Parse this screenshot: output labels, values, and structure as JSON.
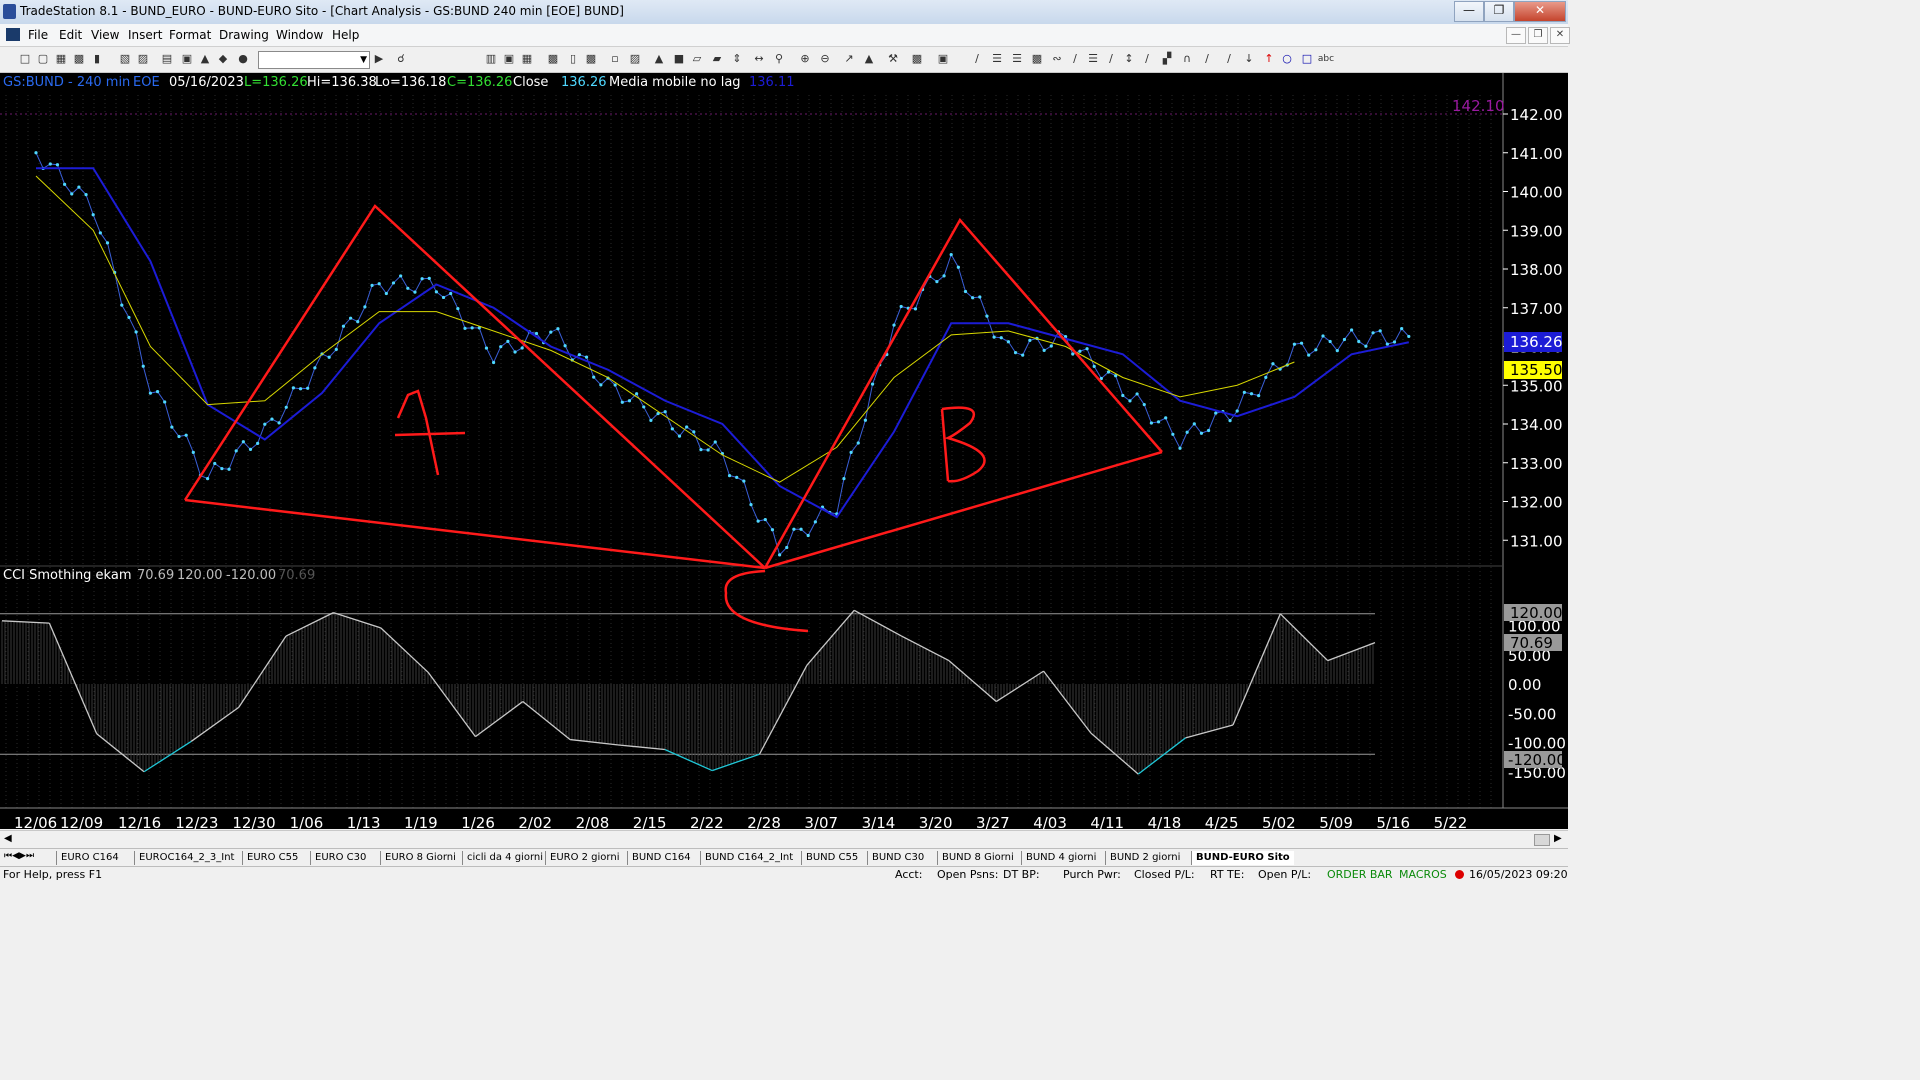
{
  "window": {
    "title": "TradeStation 8.1 - BUND_EURO - BUND-EURO Sito - [Chart Analysis - GS:BUND  240 min  [EOE] BUND]",
    "min_icon": "minimize-icon",
    "max_icon": "maximize-icon",
    "close_icon": "close-icon"
  },
  "menu": [
    "File",
    "Edit",
    "View",
    "Insert",
    "Format",
    "Drawing",
    "Window",
    "Help"
  ],
  "chart_header": {
    "symbol": "GS:BUND - 240 min",
    "session": "EOE",
    "date": "05/16/2023",
    "last": "L=136.26",
    "high": "Hi=136.38",
    "low": "Lo=136.18",
    "close_val": "C=136.26",
    "close_label": "Close",
    "close_num": "136.26",
    "ma_label": "Media mobile no lag",
    "ma_value": "136.11"
  },
  "indicator_header": {
    "name": "CCI Smothing ekam",
    "v1": "70.69",
    "v2": "120.00",
    "v3": "-120.00",
    "v4": "70.69"
  },
  "price_axis": {
    "labels": [
      "142.00",
      "141.00",
      "140.00",
      "139.00",
      "138.00",
      "137.00",
      "136.00",
      "135.00",
      "134.00",
      "133.00",
      "132.00",
      "131.00"
    ],
    "marker_last": "136.26",
    "marker_ma": "135.50",
    "top_ref": "142.10"
  },
  "cci_axis": {
    "labels": [
      "100.00",
      "50.00",
      "0.00",
      "-50.00",
      "-100.00",
      "-150.00"
    ],
    "marker_upper": "120.00",
    "marker_value": "70.69",
    "marker_lower": "-120.00"
  },
  "time_axis": [
    "12/06",
    "12/09",
    "12/16",
    "12/23",
    "12/30",
    "1/06",
    "1/13",
    "1/19",
    "1/26",
    "2/02",
    "2/08",
    "2/15",
    "2/22",
    "2/28",
    "3/07",
    "3/14",
    "3/20",
    "3/27",
    "4/03",
    "4/11",
    "4/18",
    "4/25",
    "5/02",
    "5/09",
    "5/16",
    "5/22"
  ],
  "annotations": {
    "letter_a": "A",
    "letter_b": "B",
    "letter_c": "C"
  },
  "chart_data": {
    "type": "line",
    "x_dates": [
      "12/06",
      "12/09",
      "12/16",
      "12/23",
      "12/30",
      "1/06",
      "1/13",
      "1/19",
      "1/26",
      "2/02",
      "2/08",
      "2/15",
      "2/22",
      "2/28",
      "3/07",
      "3/14",
      "3/20",
      "3/27",
      "4/03",
      "4/11",
      "4/18",
      "4/25",
      "5/02",
      "5/09",
      "5/16"
    ],
    "ylim": [
      130.4,
      142.4
    ],
    "series": [
      {
        "name": "Close",
        "color": "#4fd8ff",
        "values": [
          141.0,
          139.6,
          135.0,
          132.6,
          133.8,
          135.6,
          137.6,
          137.6,
          135.8,
          136.4,
          135.0,
          134.1,
          133.2,
          130.8,
          131.9,
          136.6,
          138.2,
          135.9,
          136.2,
          134.9,
          133.6,
          134.4,
          135.9,
          136.2,
          136.26
        ]
      },
      {
        "name": "Media mobile no lag",
        "color": "#1c1cd6",
        "values": [
          140.6,
          140.6,
          138.2,
          134.5,
          133.6,
          134.8,
          136.6,
          137.6,
          137.0,
          136.0,
          135.4,
          134.6,
          134.0,
          132.4,
          131.6,
          133.8,
          136.6,
          136.6,
          136.2,
          135.8,
          134.6,
          134.2,
          134.7,
          135.8,
          136.11
        ]
      },
      {
        "name": "Average",
        "color": "#d8d800",
        "values": [
          140.4,
          139.0,
          136.0,
          134.5,
          134.6,
          135.8,
          136.9,
          136.9,
          136.4,
          135.9,
          135.2,
          134.2,
          133.2,
          132.5,
          133.4,
          135.2,
          136.3,
          136.4,
          136.0,
          135.2,
          134.7,
          135.0,
          135.6,
          null,
          null
        ]
      }
    ],
    "cci": {
      "name": "CCI Smothing ekam",
      "ylim": [
        -160,
        140
      ],
      "levels": [
        120,
        -120
      ],
      "values": [
        108,
        104,
        -85,
        -150,
        -98,
        -40,
        82,
        122,
        96,
        20,
        -90,
        -30,
        -95,
        -104,
        -112,
        -148,
        -120,
        32,
        126,
        82,
        40,
        -30,
        22,
        -84,
        -154,
        -92,
        -70,
        120,
        40,
        70.69
      ]
    }
  }
}
